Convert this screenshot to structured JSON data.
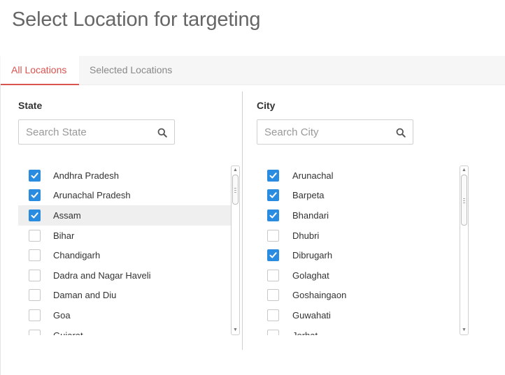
{
  "title": "Select Location for targeting",
  "tabs": [
    {
      "label": "All Locations",
      "active": true
    },
    {
      "label": "Selected Locations",
      "active": false
    }
  ],
  "state": {
    "heading": "State",
    "search_placeholder": "Search State",
    "items": [
      {
        "label": "Andhra Pradesh",
        "checked": true
      },
      {
        "label": "Arunachal Pradesh",
        "checked": true
      },
      {
        "label": "Assam",
        "checked": true,
        "highlighted": true
      },
      {
        "label": "Bihar",
        "checked": false
      },
      {
        "label": "Chandigarh",
        "checked": false
      },
      {
        "label": "Dadra and Nagar Haveli",
        "checked": false
      },
      {
        "label": "Daman and Diu",
        "checked": false
      },
      {
        "label": "Goa",
        "checked": false
      },
      {
        "label": "Gujarat",
        "checked": false
      }
    ]
  },
  "city": {
    "heading": "City",
    "search_placeholder": "Search City",
    "items": [
      {
        "label": "Arunachal",
        "checked": true
      },
      {
        "label": "Barpeta",
        "checked": true
      },
      {
        "label": "Bhandari",
        "checked": true
      },
      {
        "label": "Dhubri",
        "checked": false
      },
      {
        "label": "Dibrugarh",
        "checked": true
      },
      {
        "label": "Golaghat",
        "checked": false
      },
      {
        "label": "Goshaingaon",
        "checked": false
      },
      {
        "label": "Guwahati",
        "checked": false
      },
      {
        "label": "Jorhat",
        "checked": false
      }
    ]
  },
  "colors": {
    "accent": "#d9534f",
    "checkbox_checked": "#2a8ce0",
    "highlight_row": "#efefef"
  },
  "icons": {
    "search": "search-icon",
    "check": "check-icon"
  }
}
